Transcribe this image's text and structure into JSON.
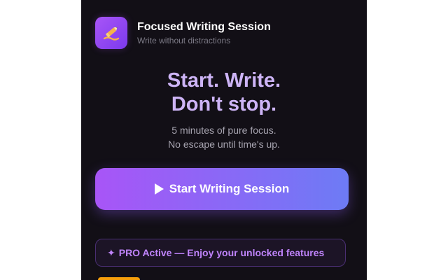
{
  "header": {
    "title": "Focused Writing Session",
    "subtitle": "Write without distractions",
    "icon": "pencil-writing-icon"
  },
  "hero": {
    "headline_line1": "Start. Write.",
    "headline_line2": "Don't stop.",
    "tagline_line1": "5 minutes of pure focus.",
    "tagline_line2": "No escape until time's up."
  },
  "actions": {
    "start_label": "Start Writing Session",
    "start_icon": "play-icon"
  },
  "pro": {
    "icon": "sparkle-icon",
    "text": "PRO Active — Enjoy your unlocked features"
  },
  "colors": {
    "background": "#120f16",
    "accent_start": "#a855f7",
    "accent_end": "#6d7bf5",
    "headline": "#cdb4f6",
    "pro_text": "#c084fc",
    "chip": "#f59e0b"
  }
}
